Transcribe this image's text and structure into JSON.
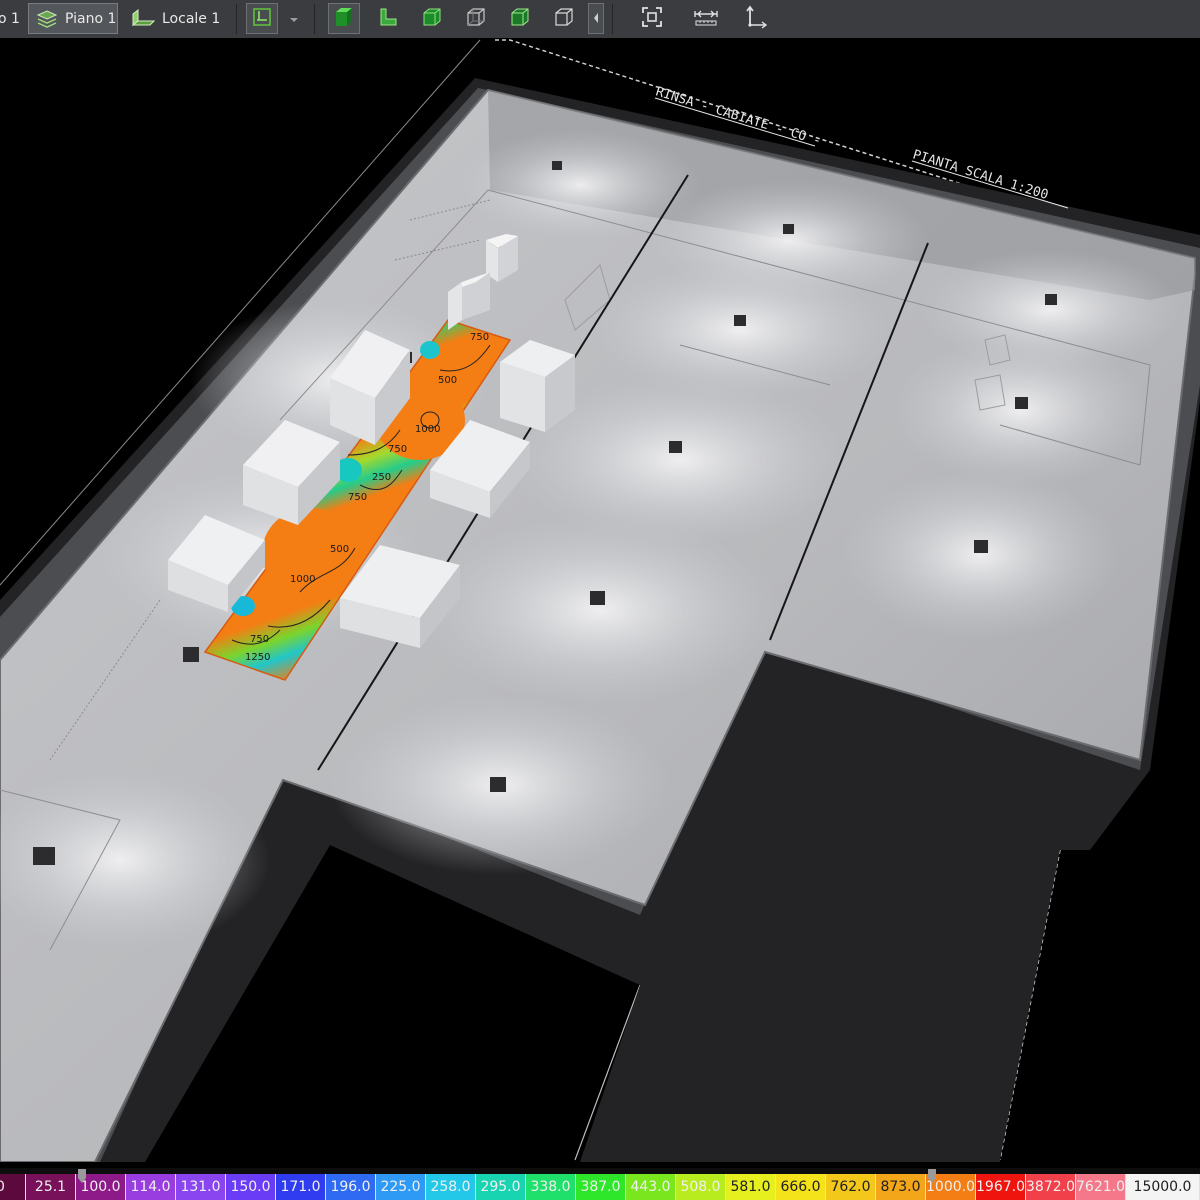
{
  "toolbar": {
    "tabs": [
      {
        "label": "o 1",
        "icon": "floor-icon",
        "active": false
      },
      {
        "label": "Piano 1",
        "icon": "floor-stack-icon",
        "active": true
      },
      {
        "label": "Locale 1",
        "icon": "room-icon",
        "active": false
      }
    ],
    "view_buttons": [
      "view-select-icon",
      "solid-green-view-icon",
      "l-shape-view-icon",
      "cube-view-icon",
      "wireframe-cube-icon",
      "shaded-cube-icon",
      "outline-cube-icon"
    ],
    "tool_buttons": [
      "zoom-fit-icon",
      "measure-icon",
      "axes-icon"
    ]
  },
  "scene": {
    "labels": {
      "title": "RINSA - CABIATE - CO -",
      "scale": "PIANTA SCALA 1:200"
    },
    "contours": [
      "750",
      "500",
      "1000",
      "750",
      "250",
      "750",
      "500",
      "1000",
      "750",
      "1250"
    ]
  },
  "legend": {
    "items": [
      {
        "value": "0",
        "color": "#5c0a3e"
      },
      {
        "value": "25.1",
        "color": "#78105a"
      },
      {
        "value": "100.0",
        "color": "#8e1a8a"
      },
      {
        "value": "114.0",
        "color": "#9a3de0"
      },
      {
        "value": "131.0",
        "color": "#8a45f0"
      },
      {
        "value": "150.0",
        "color": "#6a3cf5"
      },
      {
        "value": "171.0",
        "color": "#2f3cf0"
      },
      {
        "value": "196.0",
        "color": "#2e6bf2"
      },
      {
        "value": "225.0",
        "color": "#2e9af5"
      },
      {
        "value": "258.0",
        "color": "#23c8e8"
      },
      {
        "value": "295.0",
        "color": "#18d4b0"
      },
      {
        "value": "338.0",
        "color": "#1ee06a"
      },
      {
        "value": "387.0",
        "color": "#2ee62a"
      },
      {
        "value": "443.0",
        "color": "#7ae61e"
      },
      {
        "value": "508.0",
        "color": "#b8ec1e"
      },
      {
        "value": "581.0",
        "color": "#e6f01e"
      },
      {
        "value": "666.0",
        "color": "#f4e21a"
      },
      {
        "value": "762.0",
        "color": "#f4c81a"
      },
      {
        "value": "873.0",
        "color": "#f4a61a"
      },
      {
        "value": "1000.0",
        "color": "#f47d14"
      },
      {
        "value": "1967.0",
        "color": "#f0140f"
      },
      {
        "value": "3872.0",
        "color": "#f2404a"
      },
      {
        "value": "7621.0",
        "color": "#f4788a"
      },
      {
        "value": "15000.0",
        "color": "#f4f4f4"
      }
    ],
    "markers": [
      "100.0",
      "1000.0"
    ]
  }
}
